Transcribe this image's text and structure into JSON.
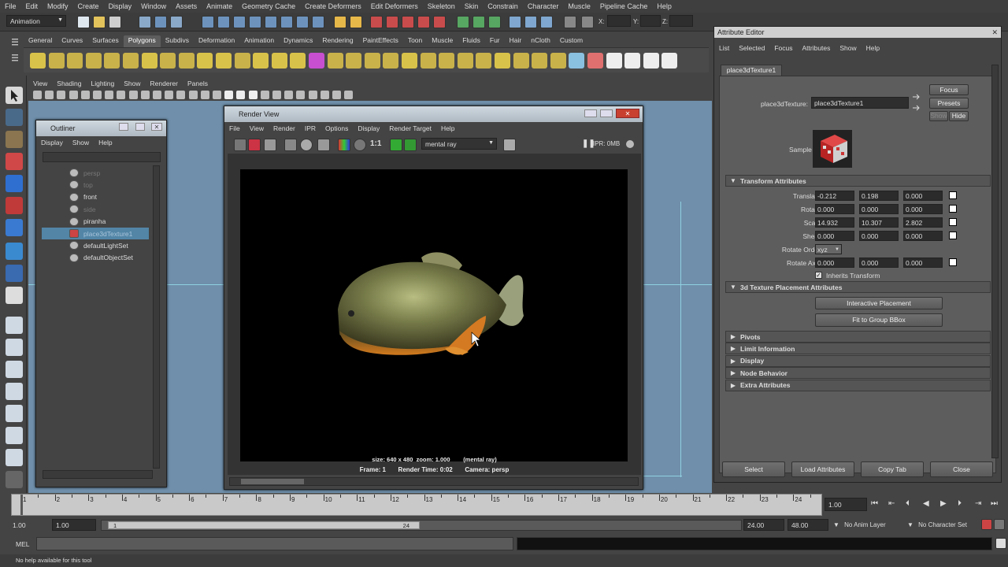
{
  "main_menu": [
    "File",
    "Edit",
    "Modify",
    "Create",
    "Display",
    "Window",
    "Assets",
    "Animate",
    "Geometry Cache",
    "Create Deformers",
    "Edit Deformers",
    "Skeleton",
    "Skin",
    "Constrain",
    "Character",
    "Muscle",
    "Pipeline Cache",
    "Help"
  ],
  "mode_dropdown": "Animation",
  "status_fields": {
    "x_label": "X:",
    "y_label": "Y:",
    "z_label": "Z:"
  },
  "shelf_tabs": [
    "General",
    "Curves",
    "Surfaces",
    "Polygons",
    "Subdivs",
    "Deformation",
    "Animation",
    "Dynamics",
    "Rendering",
    "PaintEffects",
    "Toon",
    "Muscle",
    "Fluids",
    "Fur",
    "Hair",
    "nCloth",
    "Custom"
  ],
  "active_shelf_tab": "Polygons",
  "viewport_menu": [
    "View",
    "Shading",
    "Lighting",
    "Show",
    "Renderer",
    "Panels"
  ],
  "outliner": {
    "title": "Outliner",
    "menu": [
      "Display",
      "Show",
      "Help"
    ],
    "items": [
      {
        "label": "persp",
        "state": "dim"
      },
      {
        "label": "top",
        "state": "dim"
      },
      {
        "label": "front",
        "state": "normal"
      },
      {
        "label": "side",
        "state": "dim"
      },
      {
        "label": "piranha",
        "state": "normal"
      },
      {
        "label": "place3dTexture1",
        "state": "selected"
      },
      {
        "label": "defaultLightSet",
        "state": "normal"
      },
      {
        "label": "defaultObjectSet",
        "state": "normal"
      }
    ]
  },
  "render_view": {
    "title": "Render View",
    "menu": [
      "File",
      "View",
      "Render",
      "IPR",
      "Options",
      "Display",
      "Render Target",
      "Help"
    ],
    "one_to_one": "1:1",
    "renderer": "mental ray",
    "ipr_status": "IPR: 0MB",
    "info_line1": "size: 640 x 480  zoom: 1.000        (mental ray)",
    "info_line2": "Frame: 1       Render Time: 0:02       Camera: persp"
  },
  "attribute_editor": {
    "title": "Attribute Editor",
    "menu": [
      "List",
      "Selected",
      "Focus",
      "Attributes",
      "Show",
      "Help"
    ],
    "node_tab": "place3dTexture1",
    "node_label": "place3dTexture:",
    "node_value": "place3dTexture1",
    "focus_btn": "Focus",
    "presets_btn": "Presets",
    "show_btn": "Show",
    "hide_btn": "Hide",
    "sample_label": "Sample",
    "transform_frame": "Transform Attributes",
    "translate": {
      "label": "Translate",
      "x": "-0.212",
      "y": "0.198",
      "z": "0.000"
    },
    "rotate": {
      "label": "Rotate",
      "x": "0.000",
      "y": "0.000",
      "z": "0.000"
    },
    "scale": {
      "label": "Scale",
      "x": "14.932",
      "y": "10.307",
      "z": "2.802"
    },
    "shear": {
      "label": "Shear",
      "x": "0.000",
      "y": "0.000",
      "z": "0.000"
    },
    "rotate_order": {
      "label": "Rotate Order",
      "value": "xyz"
    },
    "rotate_axis": {
      "label": "Rotate Axis",
      "x": "0.000",
      "y": "0.000",
      "z": "0.000"
    },
    "inherits_transform": "Inherits Transform",
    "placement_frame": "3d Texture Placement Attributes",
    "interactive_placement_btn": "Interactive Placement",
    "fit_bbox_btn": "Fit to Group BBox",
    "collapsed_frames": [
      "Pivots",
      "Limit Information",
      "Display",
      "Node Behavior",
      "Extra Attributes"
    ],
    "bottom_buttons": [
      "Select",
      "Load Attributes",
      "Copy Tab",
      "Close"
    ]
  },
  "timeline": {
    "ticks": [
      "1",
      "2",
      "3",
      "4",
      "5",
      "6",
      "7",
      "8",
      "9",
      "10",
      "11",
      "12",
      "13",
      "14",
      "15",
      "16",
      "17",
      "18",
      "19",
      "20",
      "21",
      "22",
      "23",
      "24"
    ],
    "current_frame": "1.00"
  },
  "range": {
    "start_a": "1.00",
    "start_b": "1.00",
    "slider_start": "1",
    "slider_end": "24",
    "end_a": "24.00",
    "end_b": "48.00",
    "anim_layer": "No Anim Layer",
    "char_set": "No Character Set"
  },
  "command_line": {
    "label": "MEL"
  },
  "help_line": "No help available for this tool"
}
